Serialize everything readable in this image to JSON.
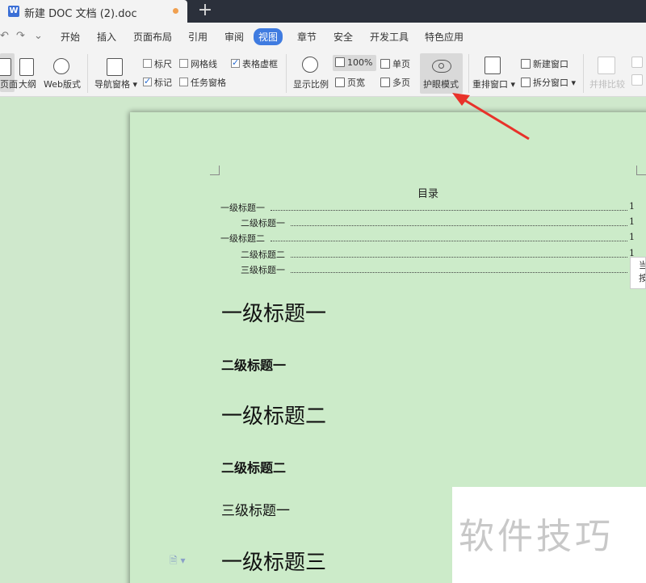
{
  "tab": {
    "title": "新建 DOC 文档 (2).doc",
    "app_letter": "W",
    "new_tab": "+"
  },
  "menu": {
    "undo": "↶",
    "redo": "↷",
    "more": "⌄",
    "items": [
      "开始",
      "插入",
      "页面布局",
      "引用",
      "审阅",
      "视图",
      "章节",
      "安全",
      "开发工具",
      "特色应用"
    ],
    "active": "视图"
  },
  "ribbon": {
    "page_view": "页面",
    "outline": "大纲",
    "web_layout": "Web版式",
    "nav_pane": "导航窗格",
    "ruler": {
      "label": "标尺",
      "checked": false
    },
    "gridlines": {
      "label": "网格线",
      "checked": false
    },
    "table_gridlines": {
      "label": "表格虚框",
      "checked": true
    },
    "markup": {
      "label": "标记",
      "checked": true
    },
    "task_pane": {
      "label": "任务窗格",
      "checked": false
    },
    "zoom": "显示比例",
    "zoom_100": "100%",
    "page_width": "页宽",
    "single_page": "单页",
    "multi_page": "多页",
    "eye_mode": "护眼模式",
    "arrange_window": "重排窗口",
    "new_window": "新建窗口",
    "split_window": "拆分窗口",
    "side_by_side": "并排比较"
  },
  "document": {
    "toc_title": "目录",
    "toc": [
      {
        "label": "一级标题一",
        "page": "1",
        "level": 1
      },
      {
        "label": "二级标题一",
        "page": "1",
        "level": 2
      },
      {
        "label": "一级标题二",
        "page": "1",
        "level": 1
      },
      {
        "label": "二级标题二",
        "page": "1",
        "level": 2
      },
      {
        "label": "三级标题一",
        "page": "1",
        "level": 2
      }
    ],
    "headings": {
      "h1_a": "一级标题一",
      "h2_a": "二级标题一",
      "h1_b": "一级标题二",
      "h2_b": "二级标题二",
      "h3_a": "三级标题一",
      "h1_c": "一级标题三"
    }
  },
  "tooltip": {
    "line1": "当",
    "line2": "按"
  },
  "watermark": "软件技巧",
  "colors": {
    "eye_mode_bg": "#cfe8cc",
    "accent": "#3f7be0",
    "arrow": "#e8322a",
    "tabbar": "#2b303b"
  }
}
